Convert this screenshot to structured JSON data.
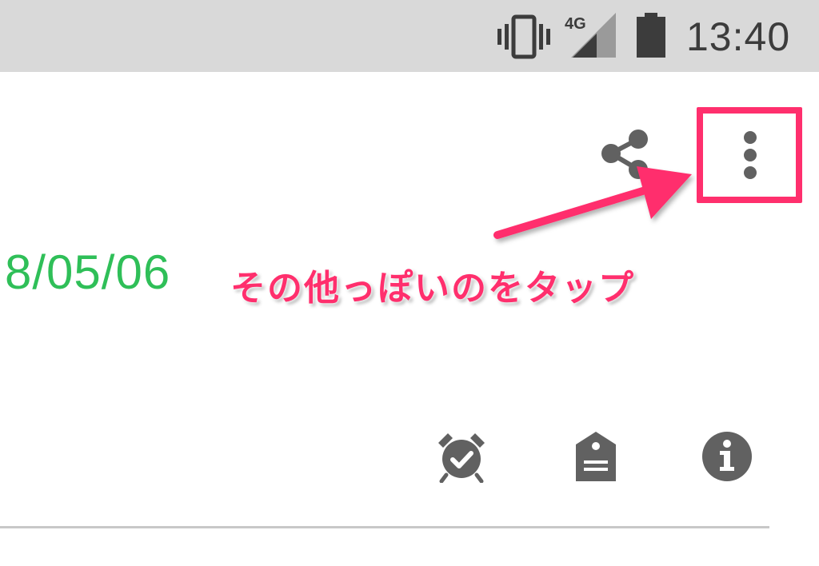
{
  "status_bar": {
    "network_label": "4G",
    "time": "13:40",
    "icons": [
      "vibrate-icon",
      "signal-icon",
      "battery-icon"
    ]
  },
  "toolbar": {
    "icons": [
      "share-icon",
      "more-vert-icon"
    ]
  },
  "content": {
    "date": "8/05/06"
  },
  "annotation": {
    "text": "その他っぽいのをタップ",
    "color": "#ff2f6d"
  },
  "actions": {
    "icons": [
      "alarm-check-icon",
      "label-icon",
      "info-icon"
    ]
  },
  "colors": {
    "status_bar_bg": "#d9d9d9",
    "icon_gray": "#616161",
    "date_green": "#2fbf58",
    "annotation_pink": "#ff2f6d"
  }
}
